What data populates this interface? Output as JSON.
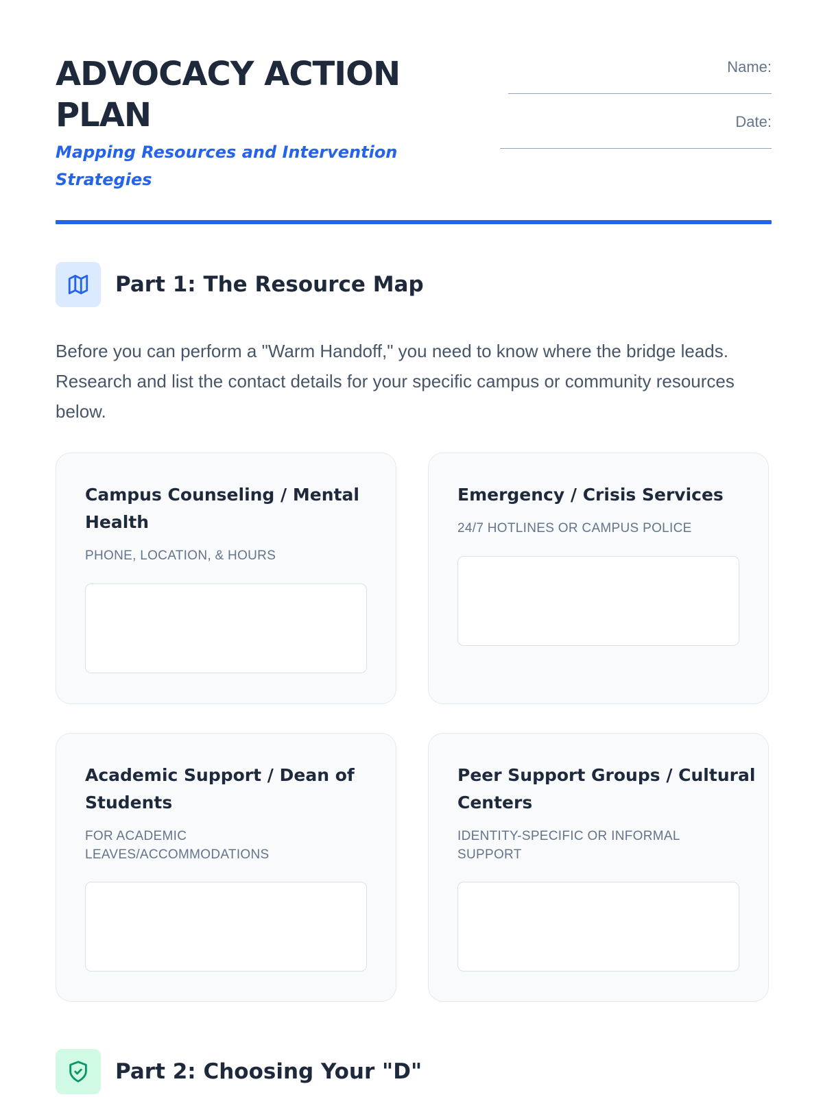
{
  "header": {
    "title": "ADVOCACY ACTION PLAN",
    "subtitle": "Mapping Resources and Intervention Strategies",
    "name_label": "Name:",
    "date_label": "Date:"
  },
  "part1": {
    "icon": "map-icon",
    "title": "Part 1: The Resource Map",
    "intro": "Before you can perform a \"Warm Handoff,\" you need to know where the bridge leads. Research and list the contact details for your specific campus or community resources below.",
    "cards": [
      {
        "title": "Campus Counseling / Mental Health",
        "subtitle": "Phone, Location, & Hours"
      },
      {
        "title": "Emergency / Crisis Services",
        "subtitle": "24/7 Hotlines or Campus Police"
      },
      {
        "title": "Academic Support / Dean of Students",
        "subtitle": "For academic leaves/accommodations"
      },
      {
        "title": "Peer Support Groups / Cultural Centers",
        "subtitle": "Identity-specific or informal support"
      }
    ]
  },
  "part2": {
    "icon": "shield-check-icon",
    "title": "Part 2: Choosing Your \"D\""
  },
  "colors": {
    "accent": "#2563eb",
    "text": "#1e293b",
    "muted": "#64748b",
    "card_bg": "#f8fafc",
    "part1_icon_bg": "#dbeafe",
    "part2_icon_bg": "#d1fae5",
    "part2_icon": "#059669"
  }
}
